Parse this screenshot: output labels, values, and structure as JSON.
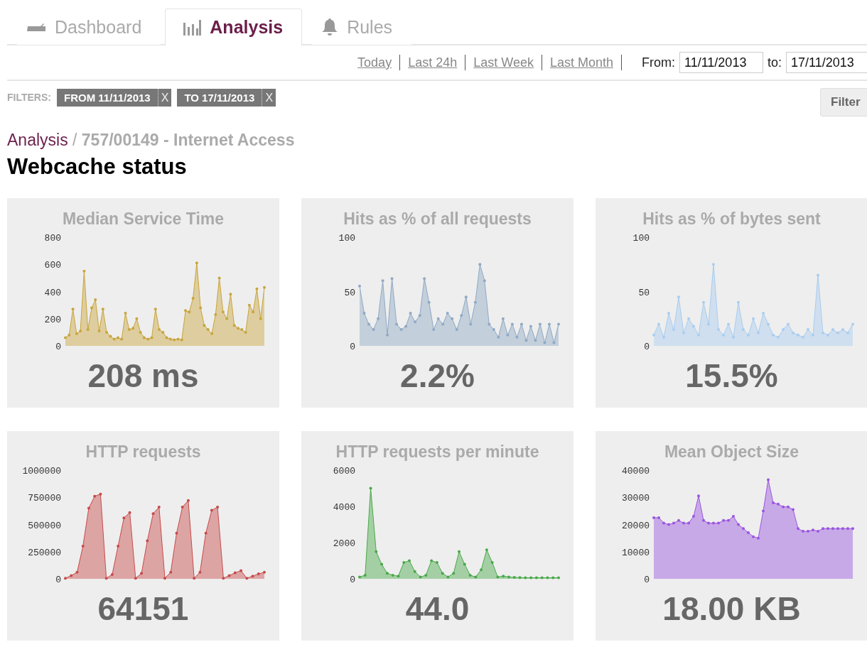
{
  "tabs": [
    {
      "label": "Dashboard",
      "selected": false
    },
    {
      "label": "Analysis",
      "selected": true
    },
    {
      "label": "Rules",
      "selected": false
    }
  ],
  "quick_ranges": [
    "Today",
    "Last 24h",
    "Last Week",
    "Last Month"
  ],
  "date_range": {
    "from_label": "From:",
    "from_value": "11/11/2013",
    "to_label": "to:",
    "to_value": "17/11/2013"
  },
  "filters": {
    "label": "FILTERS:",
    "tags": [
      {
        "text": "FROM 11/11/2013",
        "remove": "X"
      },
      {
        "text": "TO 17/11/2013",
        "remove": "X"
      }
    ],
    "button": "Filter"
  },
  "breadcrumb": {
    "root": "Analysis",
    "separator": "/",
    "current": "757/00149 - Internet Access"
  },
  "title": "Webcache status",
  "cards": [
    {
      "title": "Median Service Time",
      "value": "208 ms",
      "chart_data": {
        "type": "area",
        "ylim": [
          0,
          800
        ],
        "yticks": [
          0,
          200,
          400,
          600,
          800
        ],
        "series": [
          {
            "color": "#c9a53c",
            "values": [
              60,
              80,
              270,
              90,
              110,
              550,
              120,
              280,
              340,
              110,
              270,
              100,
              70,
              50,
              60,
              50,
              240,
              120,
              130,
              200,
              100,
              60,
              50,
              60,
              270,
              120,
              100,
              60,
              50,
              45,
              50,
              45,
              260,
              250,
              350,
              610,
              280,
              150,
              120,
              90,
              230,
              500,
              250,
              200,
              380,
              150,
              130,
              120,
              100,
              300,
              250,
              420,
              200,
              430
            ]
          }
        ]
      }
    },
    {
      "title": "Hits as % of all requests",
      "value": "2.2%",
      "chart_data": {
        "type": "area",
        "ylim": [
          0,
          100
        ],
        "yticks": [
          0,
          50,
          100
        ],
        "series": [
          {
            "color": "#8fa9c4",
            "values": [
              55,
              30,
              20,
              15,
              25,
              60,
              10,
              62,
              20,
              15,
              18,
              30,
              22,
              28,
              62,
              40,
              15,
              25,
              20,
              30,
              25,
              15,
              28,
              45,
              20,
              40,
              75,
              60,
              20,
              15,
              8,
              25,
              10,
              20,
              8,
              20,
              5,
              18,
              5,
              20,
              3,
              20,
              3,
              20
            ]
          }
        ]
      }
    },
    {
      "title": "Hits as % of bytes sent",
      "value": "15.5%",
      "chart_data": {
        "type": "area",
        "ylim": [
          0,
          100
        ],
        "yticks": [
          0,
          50,
          100
        ],
        "series": [
          {
            "color": "#a9cdf0",
            "values": [
              10,
              20,
              8,
              30,
              15,
              45,
              12,
              25,
              18,
              10,
              40,
              20,
              75,
              15,
              10,
              20,
              8,
              40,
              15,
              10,
              25,
              12,
              30,
              20,
              10,
              8,
              15,
              20,
              12,
              10,
              8,
              15,
              10,
              65,
              12,
              10,
              15,
              12,
              15,
              12,
              20
            ]
          }
        ]
      }
    },
    {
      "title": "HTTP requests",
      "value": "64151",
      "chart_data": {
        "type": "area",
        "ylim": [
          0,
          1000000
        ],
        "yticks": [
          0,
          250000,
          500000,
          750000,
          1000000
        ],
        "series": [
          {
            "color": "#c84a4a",
            "values": [
              5000,
              30000,
              60000,
              300000,
              650000,
              760000,
              780000,
              5000,
              40000,
              300000,
              560000,
              610000,
              5000,
              50000,
              350000,
              600000,
              660000,
              5000,
              60000,
              420000,
              660000,
              720000,
              5000,
              60000,
              420000,
              630000,
              660000,
              5000,
              30000,
              55000,
              75000,
              5000,
              25000,
              45000,
              60000
            ]
          }
        ]
      }
    },
    {
      "title": "HTTP requests per minute",
      "value": "44.0",
      "chart_data": {
        "type": "area",
        "ylim": [
          0,
          6000
        ],
        "yticks": [
          0,
          2000,
          4000,
          6000
        ],
        "series": [
          {
            "color": "#4aa84a",
            "values": [
              100,
              200,
              5000,
              1500,
              800,
              300,
              200,
              150,
              900,
              1000,
              400,
              100,
              200,
              1000,
              900,
              300,
              100,
              300,
              1500,
              800,
              200,
              100,
              500,
              1600,
              900,
              100,
              150,
              100,
              80,
              70,
              60,
              60,
              60,
              60,
              60,
              60,
              60
            ]
          }
        ]
      }
    },
    {
      "title": "Mean Object Size",
      "value": "18.00 KB",
      "chart_data": {
        "type": "area",
        "ylim": [
          0,
          40000
        ],
        "yticks": [
          0,
          10000,
          20000,
          30000,
          40000
        ],
        "series": [
          {
            "color": "#9a55e0",
            "values": [
              22500,
              22500,
              20500,
              20000,
              20500,
              21500,
              20500,
              20500,
              23000,
              30500,
              21500,
              20500,
              20500,
              20500,
              21500,
              21500,
              23000,
              20000,
              18500,
              17000,
              15500,
              15000,
              25000,
              36500,
              28000,
              27500,
              26500,
              26500,
              25500,
              18500,
              17500,
              17500,
              18000,
              17500,
              18500,
              18500,
              18500,
              18500,
              18500,
              18500,
              18500
            ]
          }
        ]
      }
    }
  ]
}
